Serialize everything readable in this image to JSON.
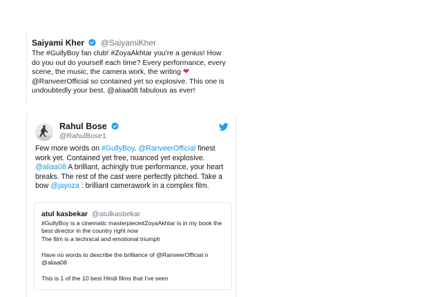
{
  "tweet1": {
    "name": "Saiyami Kher",
    "handle": "@SaiyamiKher",
    "text_a": "The #GullyBoy fan club! #ZoyaAkhtar you're a genius! How do you out do yourself each time? Every performance, every scene, the music, the camera work, the writing",
    "text_b": "@RanveerOfficial so contained yet so explosive. This one is undoubtedly your best. @aliaa08 fabulous as ever!"
  },
  "tweet2": {
    "name": "Rahul Bose",
    "handle": "@RahulBose1",
    "p1": "Few more words on ",
    "l1": "#GullyBoy",
    "p2": ". ",
    "l2": "@RanveerOfficial",
    "p3": " finest work yet. Contained yet free, nuanced yet explosive. ",
    "l3": "@aliaa08",
    "p4": " A brilliant, achingly true performance, your heart breaks. The rest of the cast were perfectly pitched. Take a bow ",
    "l4": "@jayoza",
    "p5": " : brilliant camerawork in a complex film."
  },
  "quote": {
    "name": "atul kasbekar",
    "handle": "@atulkasbekar",
    "lines": [
      "#GullyBoy is a cinematic masterpiece#ZoyaAkhtar is in my book the best director in the country right now",
      "The film is a technical and emotional triumph",
      "",
      "Have no words to describe the brilliance of @RanveerOfficial n @aliaa08",
      "",
      "This is 1 of the 10 best Hindi films that I've seen"
    ]
  },
  "colors": {
    "link": "#1b95e0",
    "handle": "#657786",
    "heart": "#e0245e",
    "border": "#e1e8ed"
  },
  "icons": [
    "verified-badge-icon",
    "heart-icon",
    "twitter-bird-icon",
    "avatar"
  ]
}
